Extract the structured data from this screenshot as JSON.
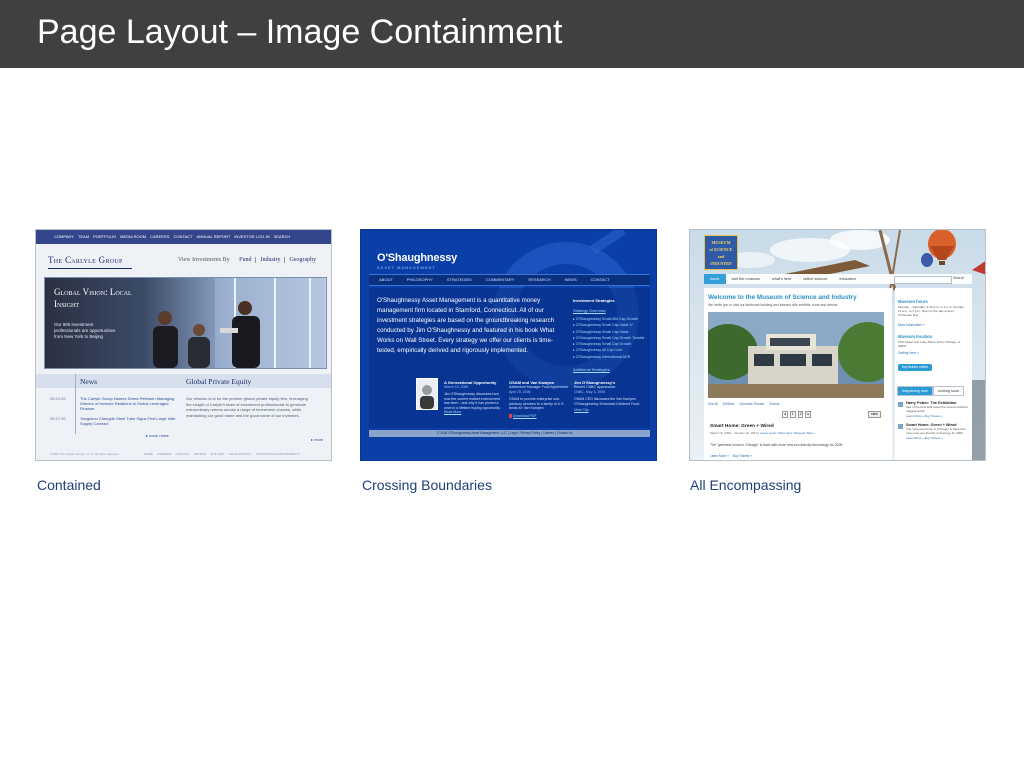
{
  "slide": {
    "title": "Page Layout – Image Containment",
    "colors": {
      "title_bar": "#404040",
      "title_text": "#ffffff",
      "caption": "#1f3f7a"
    }
  },
  "examples": [
    {
      "caption": "Contained",
      "screenshot": {
        "nav": [
          "COMPANY",
          "TEAM",
          "PORTFOLIO",
          "MEDIA ROOM",
          "CAREERS",
          "CONTACT",
          "ANNUAL REPORT",
          "INVESTOR LOG-IN",
          "SEARCH"
        ],
        "logo": "The Carlyle Group",
        "view_label": "View Investments By",
        "view_options": [
          "Fund",
          "Industry",
          "Geography"
        ],
        "hero_title": "Global Vision: Local Insight",
        "hero_text": "Our 900 investment professionals are opportunities from New York to Beijing",
        "news_heading": "News",
        "news_items": [
          {
            "date": "05.24.06",
            "text": "The Carlyle Group Names Debra Petersen Managing Director of Investor Relations in Global Leveraged Finance"
          },
          {
            "date": "05.17.06",
            "text": "Yangzhou Chengde Steel Tube Signs First Large Intle Supply Contract"
          }
        ],
        "news_more": "▸ more news",
        "pe_heading": "Global Private Equity",
        "pe_text": "Our mission is to be the premier global private equity firm, leveraging the insight of Carlyle's team of investment professionals to generate extraordinary returns across a range of investment choices, while maintaining our good name and the good name of our investors.",
        "pe_more": "▸ more",
        "footer_left": "©2005 The Carlyle Group, L.L.C. All rights reserved.",
        "footer_links": [
          "HOME",
          "CAREERS",
          "CONTACT",
          "SEARCH",
          "SITE MAP",
          "LEGAL/PRIVACY",
          "CORPORATE RESPONSIBILITY"
        ]
      }
    },
    {
      "caption": "Crossing Boundaries",
      "screenshot": {
        "logo": "O'Shaughnessy",
        "logo_sub": "ASSET MANAGEMENT",
        "nav": [
          "ABOUT",
          "PHILOSOPHY",
          "STRATEGIES",
          "COMMENTARY",
          "RESEARCH",
          "NEWS",
          "CONTACT"
        ],
        "intro": "O'Shaughnessy Asset Management is a quantitative money management firm located in Stamford, Connecticut. All of our investment strategies are based on the groundbreaking research conducted by Jim O'Shaughnessy and featured in his book What Works on Wall Street. Every strategy we offer our clients is time-tested, empirically derived and rigorously implemented.",
        "strategies_heading": "Investment Strategies",
        "strategies_intro": "Strategy Overview",
        "strategies": [
          "O'Shaughnessy Small-Mid Cap Growth",
          "O'Shaughnessy Small Cap Value IV",
          "O'Shaughnessy Small Cap Value",
          "O'Shaughnessy Small Cap Growth Taxable",
          "O'Shaughnessy Small Cap Growth",
          "O'Shaughnessy All Cap Core",
          "O'Shaughnessy International ADR"
        ],
        "strategies_more": "Additional Strategies",
        "col1_title": "A Generational Opportunity",
        "col1_date": "March 15, 2006",
        "col1_text": "Jim O'Shaughnessy discusses how now the current market environment has been - and why it has proved a once in a lifetime buying opportunity.",
        "col1_link": "Read More",
        "col2_title": "OSAM and Van Kampen",
        "col2_sub": "Addendum Manager Fund Agreement",
        "col2_date": "April 20, 2006",
        "col2_text": "OSAM to provide enterprise sub-advisory services to a family of U.S. funds for Van Kampen.",
        "col2_link": "Download PDF",
        "col3_title": "Jim O'Shaughnessy's",
        "col3_sub": "Recent CNBC appearance",
        "col3_date": "CNBC, May 3, 2006",
        "col3_text": "OSAM CEO discusses the Van Kampen O'Shaughnessy Enhanced Dividend Fund.",
        "col3_link": "View Clip",
        "footer": "© 2006 O'Shaughnessy Asset Management, LLC. | Legal / Privacy Policy | Careers | Contact Us"
      }
    },
    {
      "caption": "All Encompassing",
      "screenshot": {
        "logo": [
          "MUSEUM",
          "of SCIENCE",
          "and",
          "INDUSTRY"
        ],
        "nav": [
          "home",
          "visit the museum",
          "what's here",
          "online science",
          "education"
        ],
        "search_button": "Search",
        "welcome": "Welcome to the Museum of Science and Industry",
        "tagline": "We invite you to visit our landmark building and interact with exhibits, tours and demos",
        "subnav": [
          "See All",
          "Exhibits",
          "Omnimax Theater",
          "Events"
        ],
        "hours_heading": "Museum hours",
        "hours_text": "Monday – Saturday: 9:30 a.m. to 4 p.m. Sunday: 11 a.m. to 4 p.m. Open in the day except Christmas Day",
        "hours_link": "More Information »",
        "location_heading": "Museum location",
        "location_text": "57th Street and Lake Shore Drive Chicago, IL 60637",
        "location_link": "Getting Here »",
        "tickets_button": "buy tickets online",
        "tabs": [
          "happening now",
          "coming soon"
        ],
        "feature_title": "Smart Home: Green + Wired",
        "feature_date": "March 15, 2006 – January 22, 2010",
        "feature_links": [
          "Lower Level",
          "Start Here",
          "Museum Map »"
        ],
        "feature_text": "The \"greenest home in Chicago\" is back with more new eco-friendly technology for 2009.",
        "feature_actions": [
          "Learn More »",
          "Buy Tickets »"
        ],
        "pager": [
          "◂",
          "1",
          "2",
          "▸"
        ],
        "pager_more": "view",
        "events": [
          {
            "title": "Harry Potter: The Exhibition",
            "text": "See of the best kids travel the famous wizard's magical world.",
            "links": [
              "Learn More »",
              "Buy Tickets »"
            ]
          },
          {
            "title": "Smart Home: Green + Wired",
            "text": "The \"greenest home in Chicago\" is back with more new eco-friendly technology for 2009.",
            "links": [
              "Learn More »",
              "Buy Tickets »"
            ]
          }
        ]
      }
    }
  ]
}
